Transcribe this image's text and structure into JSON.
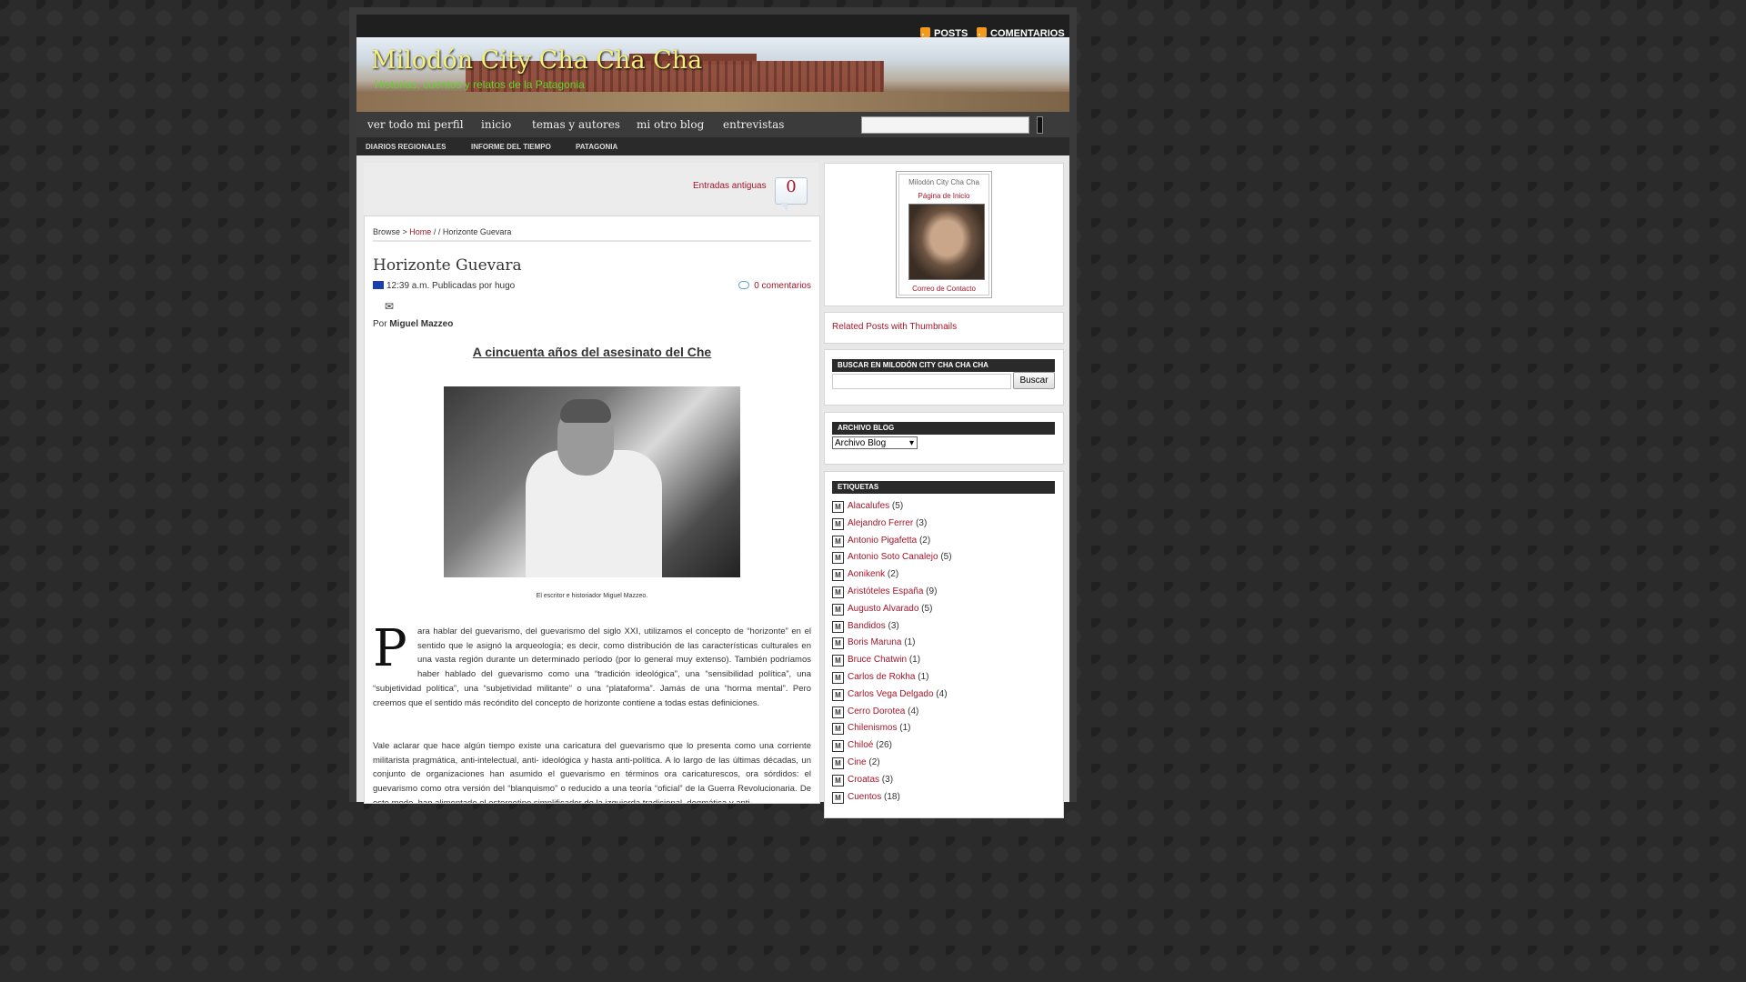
{
  "topbar": {
    "posts_label": "POSTS",
    "comments_label": "COMENTARIOS"
  },
  "header": {
    "title": "Milodón City Cha Cha Cha",
    "description": "Historias, cuentos y relatos de la Patagonia"
  },
  "nav": {
    "items": [
      "ver todo mi perfil",
      "inicio",
      "temas y autores",
      "mi otro blog",
      "entrevistas"
    ]
  },
  "subnav": {
    "items": [
      "DIARIOS REGIONALES",
      "INFORME DEL TIEMPO",
      "PATAGONIA"
    ]
  },
  "main": {
    "older_entries": "Entradas antiguas",
    "comment_bubble": "0",
    "breadcrumb": {
      "browse": "Browse >",
      "home": "Home",
      "tail": "/ / Horizonte Guevara"
    },
    "post_title": "Horizonte Guevara",
    "meta": "12:39 a.m. Publicadas por hugo",
    "comments_link": "0 comentarios",
    "mail_icon": "✉",
    "byline_prefix": "Por",
    "byline_author": "Miguel Mazzeo",
    "headline": "A cincuenta años del asesinato del Che",
    "caption": "El escritor e historiador Miguel Mazzeo.",
    "dropcap": "P",
    "para1": "ara hablar del guevarismo, del guevarismo del siglo XXI, utilizamos el concepto de “horizonte” en el sentido que le asignó la arqueología; es decir, como distribución de las características culturales en una vasta región durante un determinado período (por lo general muy extenso). También podríamos haber hablado del guevarismo como una “tradición ideológica”, una “sensibilidad política”, una “subjetividad política”, una “subjetividad militante” o una “plataforma”. Jamás de una “horma mental”. Pero creemos que el sentido más recóndito del concepto de horizonte contiene a todas estas definiciones.",
    "para2": "Vale aclarar que hace algún tiempo existe una caricatura del guevarismo que lo presenta como una corriente militarista pragmática, anti-intelectual, anti- ideológica y hasta anti-política. A lo largo de las últimas décadas, un conjunto de organizaciones han asumido el guevarismo en términos ora caricaturescos, ora sórdidos: el guevarismo como otra versión del “blanquismo” o reducido a una teoría “oficial” de la Guerra Revolucionaria. De este modo, han alimentado el estereotipo simplificador de la izquierda tradicional, dogmática y anti-"
  },
  "sidebar": {
    "profile": {
      "name": "Milodón City Cha Cha",
      "home": "Página de Inicio",
      "contact": "Correo de Contacto"
    },
    "related": "Related Posts with Thumbnails",
    "search": {
      "title": "BUSCAR EN MILODÓN CITY CHA CHA CHA",
      "button": "Buscar"
    },
    "archive": {
      "title": "ARCHIVO BLOG",
      "selected": "Archivo Blog"
    },
    "tags": {
      "title": "ETIQUETAS",
      "items": [
        {
          "label": "Alacalufes",
          "count": "(5)"
        },
        {
          "label": "Alejandro Ferrer",
          "count": "(3)"
        },
        {
          "label": "Antonio Pigafetta",
          "count": "(2)"
        },
        {
          "label": "Antonio Soto Canalejo",
          "count": "(5)"
        },
        {
          "label": "Aonikenk",
          "count": "(2)"
        },
        {
          "label": "Aristóteles España",
          "count": "(9)"
        },
        {
          "label": "Augusto Alvarado",
          "count": "(5)"
        },
        {
          "label": "Bandidos",
          "count": "(3)"
        },
        {
          "label": "Boris Maruna",
          "count": "(1)"
        },
        {
          "label": "Bruce Chatwin",
          "count": "(1)"
        },
        {
          "label": "Carlos de Rokha",
          "count": "(1)"
        },
        {
          "label": "Carlos Vega Delgado",
          "count": "(4)"
        },
        {
          "label": "Cerro Dorotea",
          "count": "(4)"
        },
        {
          "label": "Chilenismos",
          "count": "(1)"
        },
        {
          "label": "Chiloé",
          "count": "(26)"
        },
        {
          "label": "Cine",
          "count": "(2)"
        },
        {
          "label": "Croatas",
          "count": "(3)"
        },
        {
          "label": "Cuentos",
          "count": "(18)"
        }
      ]
    }
  },
  "colors": {
    "link": "#a3162a",
    "accent": "#f5f07a",
    "tagline": "#5fd629"
  }
}
